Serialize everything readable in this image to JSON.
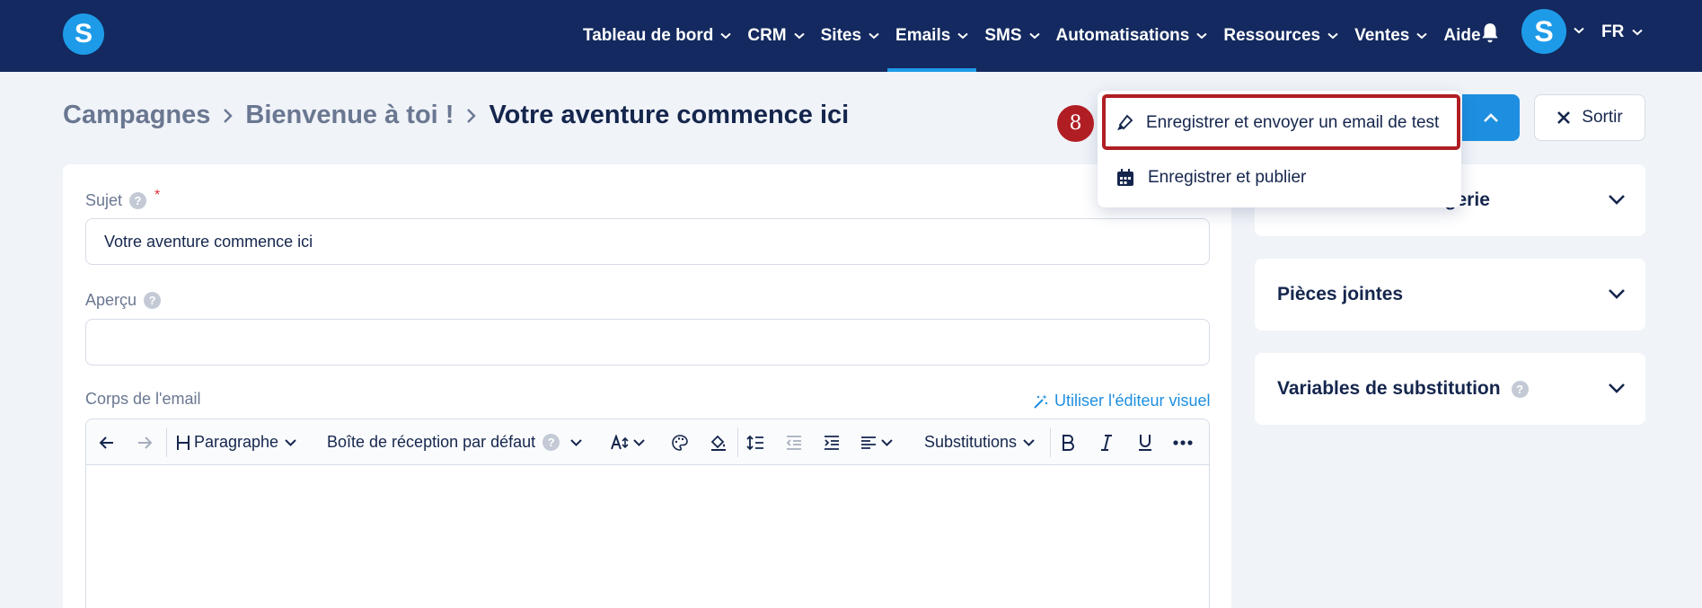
{
  "colors": {
    "nav_bg": "#13295f",
    "accent": "#1e9be8",
    "highlight": "#b01e24"
  },
  "nav": {
    "logo_letter": "S",
    "items": [
      {
        "label": "Tableau de bord",
        "active": false
      },
      {
        "label": "CRM",
        "active": false
      },
      {
        "label": "Sites",
        "active": false
      },
      {
        "label": "Emails",
        "active": true
      },
      {
        "label": "SMS",
        "active": false
      },
      {
        "label": "Automatisations",
        "active": false
      },
      {
        "label": "Ressources",
        "active": false
      },
      {
        "label": "Ventes",
        "active": false
      },
      {
        "label": "Aide",
        "active": false
      }
    ],
    "avatar_letter": "S",
    "language": "FR"
  },
  "breadcrumb": {
    "items": [
      "Campagnes",
      "Bienvenue à toi !"
    ],
    "current": "Votre aventure commence ici"
  },
  "header": {
    "exit_label": "Sortir"
  },
  "dropdown": {
    "items": [
      {
        "label": "Enregistrer et envoyer un email de test",
        "icon": "pen-icon"
      },
      {
        "label": "Enregistrer et publier",
        "icon": "calendar-icon"
      }
    ]
  },
  "annotation": {
    "step": "8"
  },
  "form": {
    "subject_label": "Sujet",
    "subject_value": "Votre aventure commence ici",
    "preview_label": "Aperçu",
    "preview_value": "",
    "body_label": "Corps de l'email",
    "visual_editor_link": "Utiliser l'éditeur visuel"
  },
  "toolbar": {
    "paragraph": "Paragraphe",
    "inbox": "Boîte de réception par défaut",
    "substitutions": "Substitutions"
  },
  "side_panels": [
    {
      "title": "agerie"
    },
    {
      "title": "Pièces jointes"
    },
    {
      "title": "Variables de substitution"
    }
  ]
}
